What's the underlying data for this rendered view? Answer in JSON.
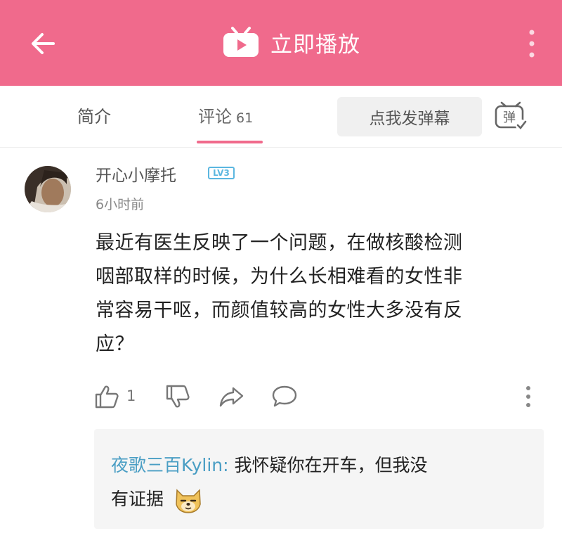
{
  "topbar": {
    "play_label": "立即播放",
    "bg_color": "#f06a8c"
  },
  "tabs": {
    "intro_label": "简介",
    "comments_label": "评论",
    "comments_count": "61",
    "danmaku_label": "点我发弹幕",
    "danmaku_icon_text": "弹"
  },
  "comment": {
    "username": "开心小摩托",
    "level": "LV3",
    "timestamp": "6小时前",
    "lines": [
      "最近有医生反映了一个问题，在做核酸检测",
      "咽部取样的时候，为什么长相难看的女性非",
      "常容易干呕，而颜值较高的女性大多没有反",
      "应？"
    ],
    "like_count": "1"
  },
  "reply": {
    "author": "夜歌三百Kylin",
    "separator": ": ",
    "text_line1": "我怀疑你在开车，但我没",
    "text_line2": "有证据",
    "author_color": "#4a9ec4"
  },
  "icons": [
    "back-arrow-icon",
    "tv-play-icon",
    "more-vertical-icon",
    "danmaku-toggle-icon",
    "thumbs-up-icon",
    "thumbs-down-icon",
    "share-icon",
    "reply-bubble-icon",
    "doge-emoji-icon"
  ]
}
